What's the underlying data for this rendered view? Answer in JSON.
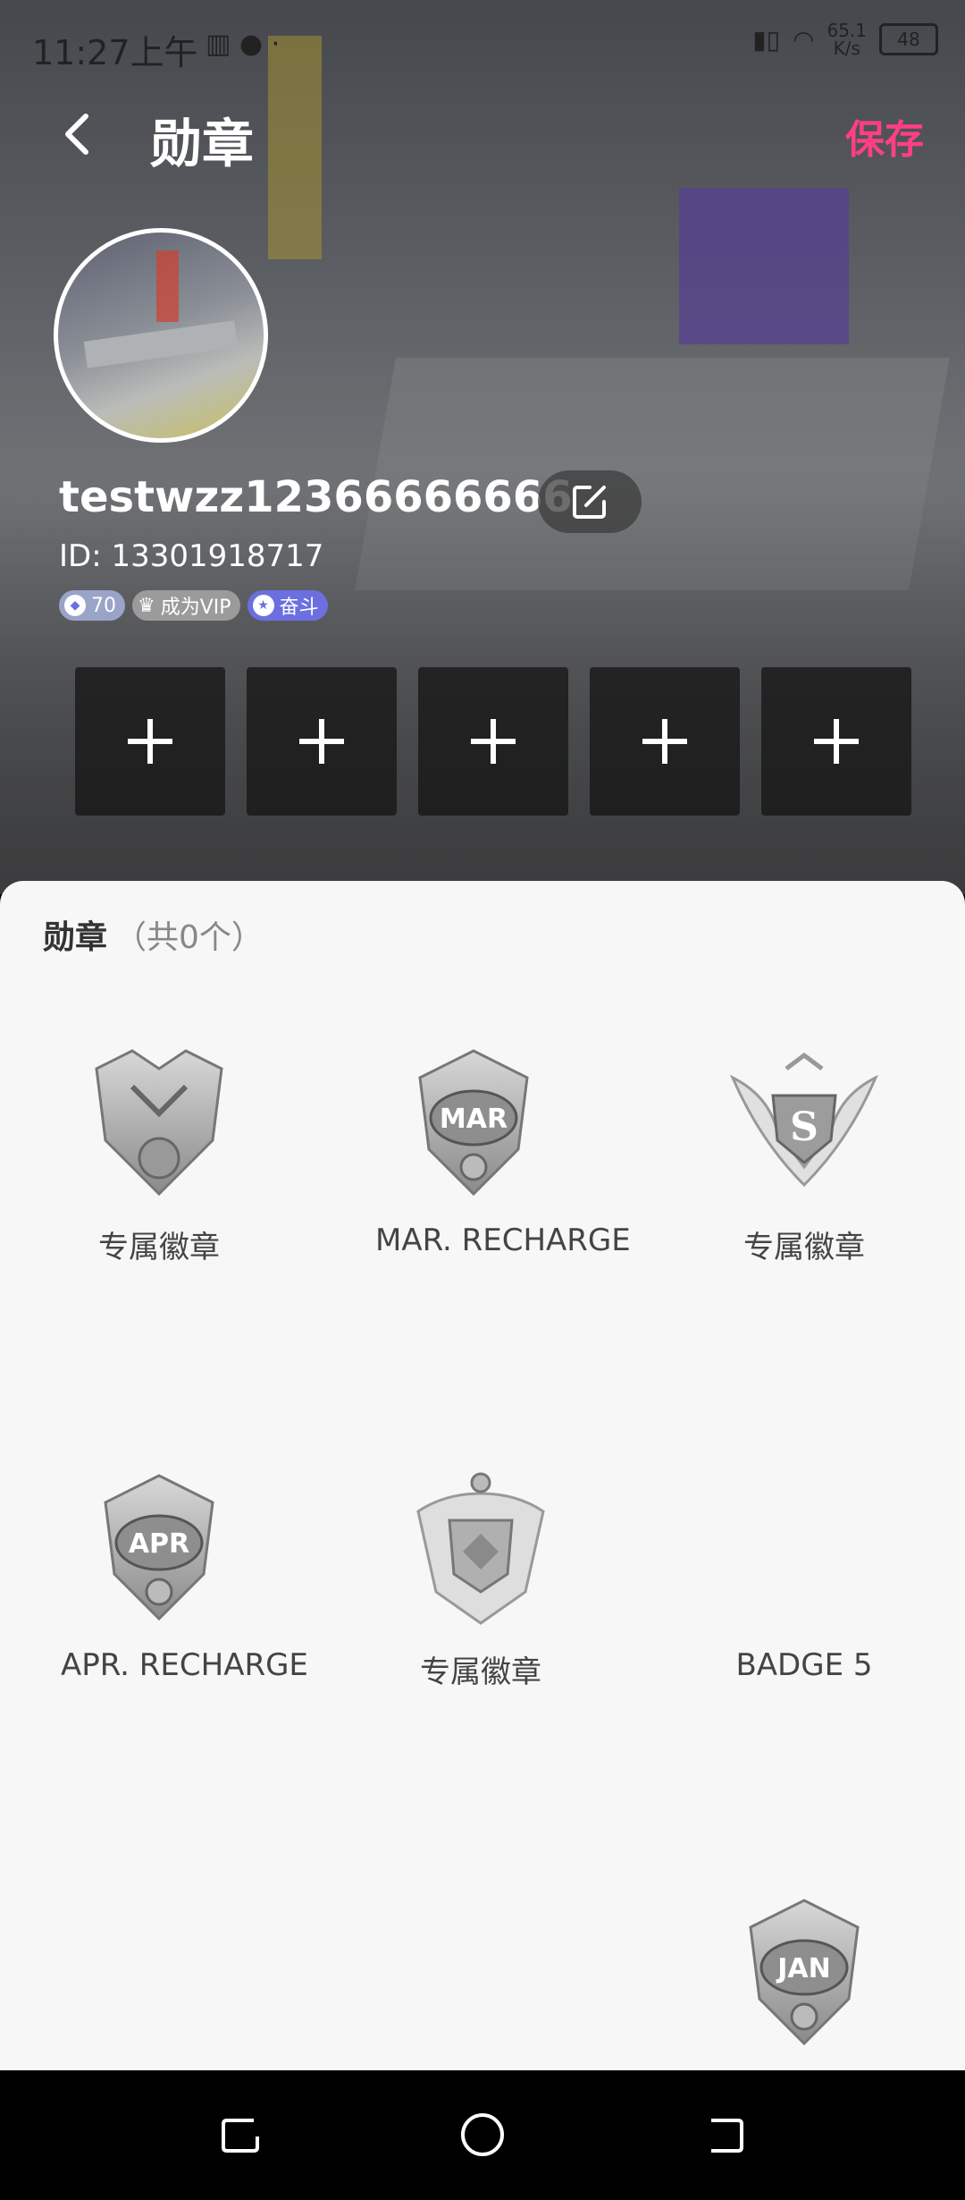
{
  "status_bar": {
    "time": "11:27上午",
    "network_speed": "65.1\nK/s",
    "battery": "48"
  },
  "header": {
    "title": "勋章",
    "save_label": "保存"
  },
  "profile": {
    "username": "testwzz12366666666",
    "id_text": "ID: 13301918717",
    "level_value": "70",
    "vip_label": "成为VIP",
    "rank_label": "奋斗"
  },
  "slots": [
    {
      "label": "+"
    },
    {
      "label": "+"
    },
    {
      "label": "+"
    },
    {
      "label": "+"
    },
    {
      "label": "+"
    }
  ],
  "medals_section": {
    "label": "勋章",
    "count_text": "（共0个）",
    "items": [
      {
        "name": "专属徽章",
        "emblem": "",
        "icon": "guardian-badge-icon"
      },
      {
        "name": "MAR. RECHARGE",
        "emblem": "MAR",
        "icon": "mar-recharge-badge-icon"
      },
      {
        "name": "专属徽章",
        "emblem": "S",
        "icon": "s-badge-icon"
      },
      {
        "name": "APR. RECHARGE",
        "emblem": "APR",
        "icon": "apr-recharge-badge-icon"
      },
      {
        "name": "专属徽章",
        "emblem": "",
        "icon": "shield-badge-icon"
      },
      {
        "name": "BADGE 5",
        "emblem": "",
        "icon": "badge-5-icon"
      },
      {
        "name": "",
        "emblem": "JAN",
        "icon": "jan-recharge-badge-icon"
      }
    ]
  },
  "colors": {
    "accent": "#ff3f82",
    "sheet_bg": "#f7f7f7",
    "slot_bg": "#141414"
  }
}
